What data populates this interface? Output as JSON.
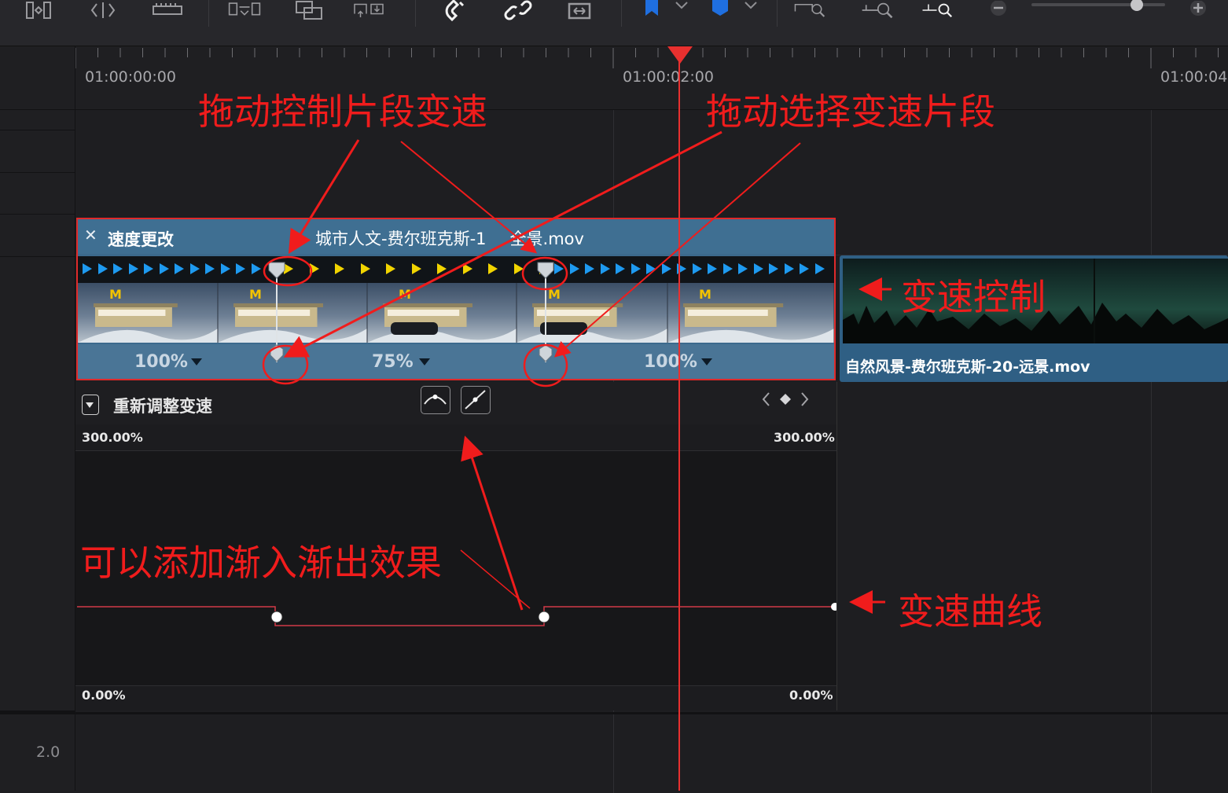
{
  "timeline": {
    "ruler_labels": [
      "01:00:00:00",
      "01:00:02:00",
      "01:00:04"
    ],
    "track_number": "2.0"
  },
  "clip": {
    "speed_change_title": "速度更改",
    "name": "城市人文-费尔班克斯-1",
    "name_suffix": "全景.mov",
    "segments": [
      {
        "speed": "100%"
      },
      {
        "speed": "75%"
      },
      {
        "speed": "100%"
      }
    ]
  },
  "clip2": {
    "name": "自然风景-费尔班克斯-20-远景.mov"
  },
  "retime": {
    "title": "重新调整变速",
    "top_left": "300.00%",
    "top_right": "300.00%",
    "bottom_left": "0.00%",
    "bottom_right": "0.00%"
  },
  "annotations": {
    "drag_segment_speed": "拖动控制片段变速",
    "drag_select_segment": "拖动选择变速片段",
    "speed_control": "变速控制",
    "ease_in_out": "可以添加渐入渐出效果",
    "speed_curve": "变速曲线"
  },
  "colors": {
    "annotation_red": "#f01c1c",
    "playhead": "#e8302f",
    "clip_blue": "#3f6f92",
    "arrow_blue": "#1e9af0",
    "arrow_yellow": "#f1d400"
  }
}
